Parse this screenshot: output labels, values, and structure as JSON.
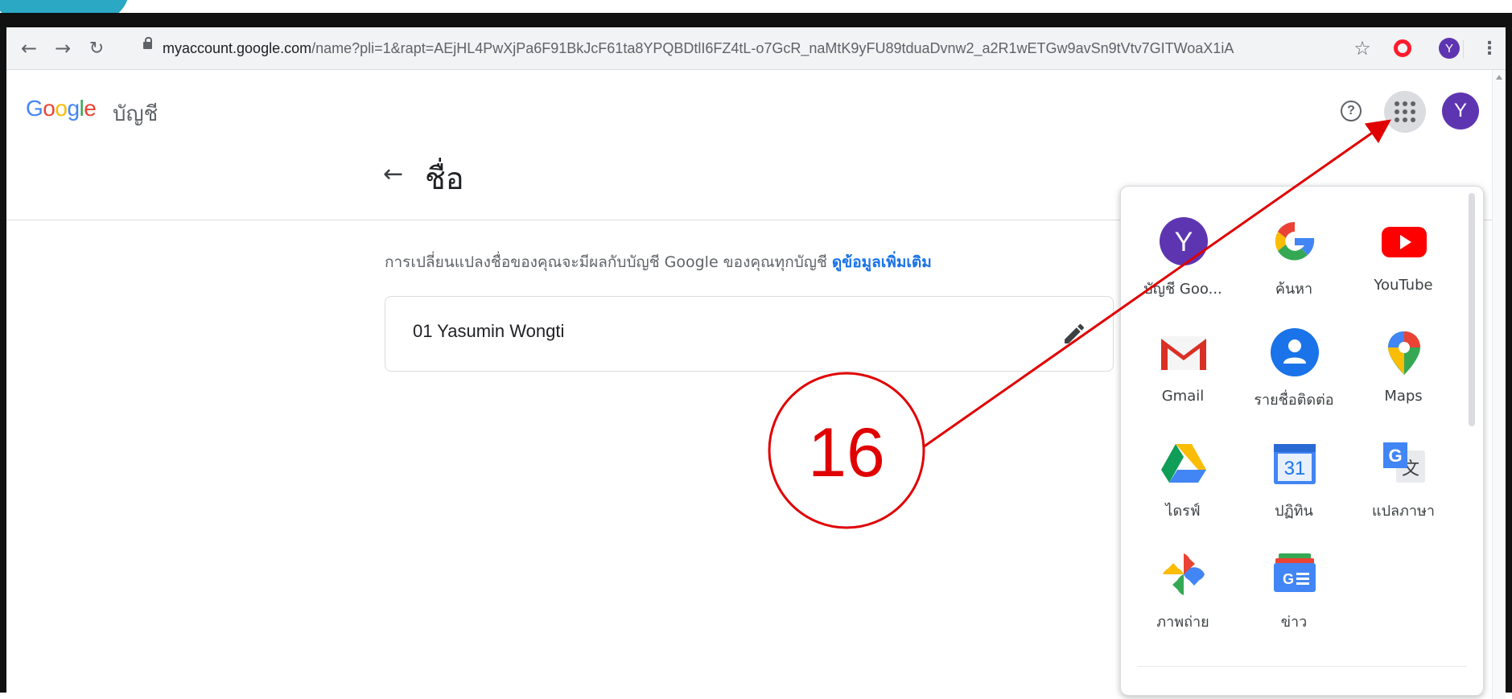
{
  "browser": {
    "url_host": "myaccount.google.com",
    "url_path": "/name?pli=1&rapt=AEjHL4PwXjPa6F91BkJcF61ta8YPQBDtlI6FZ4tL-o7GcR_naMtK9yFU89tduaDvnw2_a2R1wETGw9avSn9tVtv7GITWoaX1iA",
    "profile_initial": "Y"
  },
  "header": {
    "logo_letters": [
      "G",
      "o",
      "o",
      "g",
      "l",
      "e"
    ],
    "logo_colors": [
      "#4285f4",
      "#ea4335",
      "#fbbc05",
      "#4285f4",
      "#34a853",
      "#ea4335"
    ],
    "product": "บัญชี",
    "help_glyph": "?",
    "avatar_initial": "Y"
  },
  "main": {
    "title": "ชื่อ",
    "description": "การเปลี่ยนแปลงชื่อของคุณจะมีผลกับบัญชี Google ของคุณทุกบัญชี",
    "learn_more": "ดูข้อมูลเพิ่มเติม",
    "name_value": "01 Yasumin Wongti"
  },
  "apps": [
    {
      "label": "บัญชี Goo...",
      "icon": "account-icon"
    },
    {
      "label": "ค้นหา",
      "icon": "google-search-icon"
    },
    {
      "label": "YouTube",
      "icon": "youtube-icon"
    },
    {
      "label": "Gmail",
      "icon": "gmail-icon"
    },
    {
      "label": "รายชื่อติดต่อ",
      "icon": "contacts-icon"
    },
    {
      "label": "Maps",
      "icon": "maps-icon"
    },
    {
      "label": "ไดรฟ์",
      "icon": "drive-icon"
    },
    {
      "label": "ปฏิทิน",
      "icon": "calendar-icon",
      "badge": "31"
    },
    {
      "label": "แปลภาษา",
      "icon": "translate-icon"
    },
    {
      "label": "ภาพถ่าย",
      "icon": "photos-icon"
    },
    {
      "label": "ข่าว",
      "icon": "news-icon"
    }
  ],
  "annotation": {
    "step_number": "16",
    "color": "#e00000"
  },
  "colors": {
    "accent_purple": "#5e35b1",
    "link_blue": "#1a73e8",
    "teal_corner": "#2aa8c4"
  }
}
